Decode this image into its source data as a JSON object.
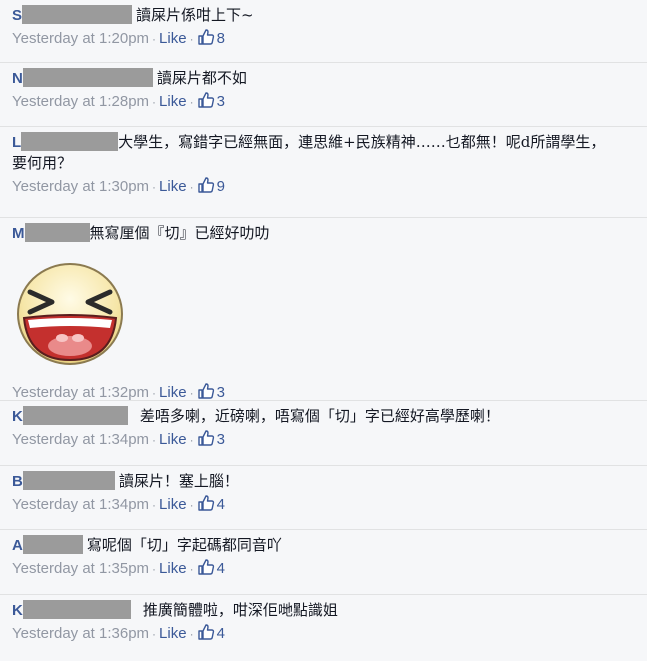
{
  "comments": [
    {
      "author_initial": "S",
      "redact_width": 110,
      "text": "讀屎片係咁上下~",
      "time": "Yesterday at 1:20pm",
      "like_label": "Like",
      "likes": "8",
      "height": 63
    },
    {
      "author_initial": "N",
      "redact_width": 130,
      "text": "讀屎片都不如",
      "time": "Yesterday at 1:28pm",
      "like_label": "Like",
      "likes": "3",
      "height": 64
    },
    {
      "author_initial": "L",
      "redact_width": 97,
      "text": "大學生，寫錯字已經無面，連思維+民族精神……乜都無！呢d所謂學生，要何用？",
      "time": "Yesterday at 1:30pm",
      "like_label": "Like",
      "likes": "9",
      "height": 91
    },
    {
      "author_initial": "M",
      "redact_width": 65,
      "text": "無寫厘個『切』已經好叻叻",
      "time": "Yesterday at 1:32pm",
      "like_label": "Like",
      "likes": "3",
      "height": 183
    },
    {
      "author_initial": "K",
      "redact_width": 105,
      "text": "差唔多喇，近磅喇，唔寫個「切」字已經好高學歷喇！",
      "time": "Yesterday at 1:34pm",
      "like_label": "Like",
      "likes": "3",
      "height": 65
    },
    {
      "author_initial": "B",
      "redact_width": 92,
      "text": "讀屎片！塞上腦！",
      "time": "Yesterday at 1:34pm",
      "like_label": "Like",
      "likes": "4",
      "height": 64
    },
    {
      "author_initial": "A",
      "redact_width": 60,
      "text": "寫呢個「切」字起碼都同音吖",
      "time": "Yesterday at 1:35pm",
      "like_label": "Like",
      "likes": "4",
      "height": 65
    },
    {
      "author_initial": "K",
      "redact_width": 108,
      "text": "推廣簡體啦，咁深佢哋點識姐",
      "time": "Yesterday at 1:36pm",
      "like_label": "Like",
      "likes": "4",
      "height": 66
    }
  ],
  "sticker_name": "laughing-face-sticker",
  "colors": {
    "link": "#3b5998",
    "meta": "#9197a3",
    "background": "#f6f7f9"
  }
}
